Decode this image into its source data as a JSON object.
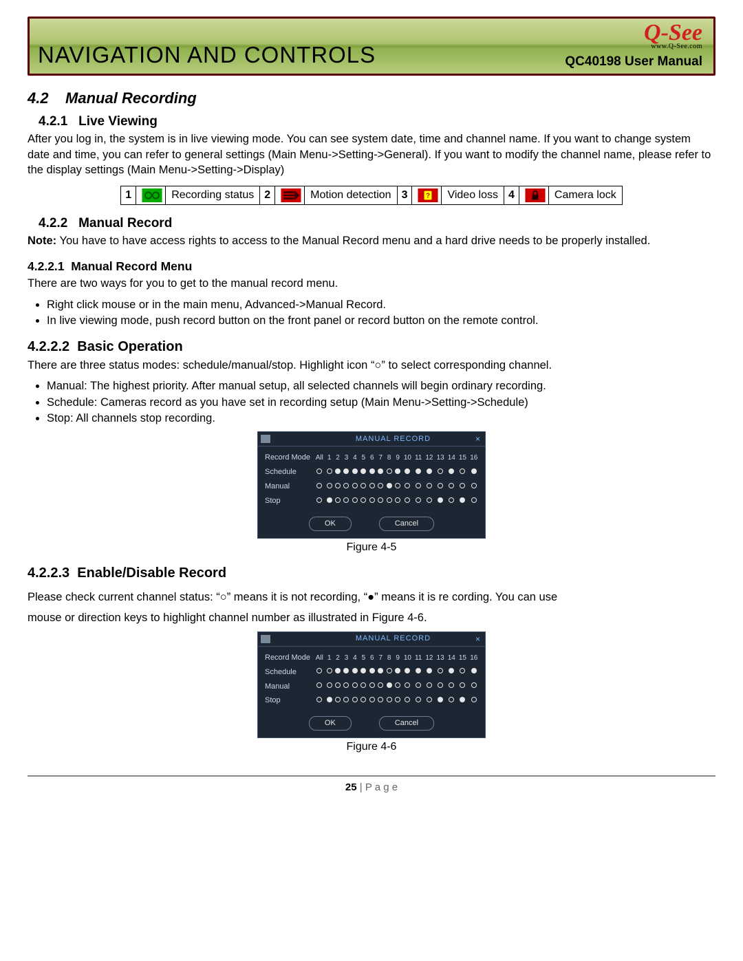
{
  "header": {
    "title": "NAVIGATION AND CONTROLS",
    "brand": "Q-See",
    "brand_url": "www.Q-See.com",
    "subtitle": "QC40198 User Manual"
  },
  "s42": {
    "num": "4.2",
    "title": "Manual Recording"
  },
  "s421": {
    "num": "4.2.1",
    "title": "Live Viewing",
    "body": "After you log in, the system is in live viewing mode. You can see system date, time and channel name. If you want to change system date and time, you can refer to general settings (Main Menu->Setting->General). If you want to modify the channel name, please refer to the display settings (Main Menu->Setting->Display)"
  },
  "legend": [
    {
      "n": "1",
      "label": "Recording status",
      "icon": "rec"
    },
    {
      "n": "2",
      "label": "Motion detection",
      "icon": "motion"
    },
    {
      "n": "3",
      "label": "Video loss",
      "icon": "vloss"
    },
    {
      "n": "4",
      "label": "Camera lock",
      "icon": "lock"
    }
  ],
  "s422": {
    "num": "4.2.2",
    "title": "Manual Record",
    "note_lead": "Note:",
    "note": " You have to have access rights to access to the Manual Record menu and a hard drive needs to be properly installed."
  },
  "s4221": {
    "num": "4.2.2.1",
    "title": "Manual Record Menu",
    "lead": "There are two ways for you to get to the manual record menu.",
    "items": [
      "Right click mouse or in the main menu, Advanced->Manual Record.",
      "In live viewing mode, push record button on the front panel or record button on the remote control."
    ]
  },
  "s4222": {
    "num": "4.2.2.2",
    "title": "Basic Operation",
    "lead": "There are three status modes: schedule/manual/stop. Highlight icon “○”  to select corresponding channel.",
    "items": [
      "Manual: The highest priority. After manual setup, all selected channels will begin ordinary recording.",
      "Schedule: Cameras record as you have set in recording setup (Main Menu->Setting->Schedule)",
      "Stop: All channels stop recording."
    ]
  },
  "dialog": {
    "title": "MANUAL RECORD",
    "close": "×",
    "col_mode": "Record Mode",
    "col_all": "All",
    "channels": [
      "1",
      "2",
      "3",
      "4",
      "5",
      "6",
      "7",
      "8",
      "9",
      "10",
      "11",
      "12",
      "13",
      "14",
      "15",
      "16"
    ],
    "rows": [
      {
        "label": "Schedule",
        "all": "off",
        "v": [
          "off",
          "on",
          "on",
          "on",
          "on",
          "on",
          "on",
          "off",
          "on",
          "on",
          "on",
          "on",
          "off",
          "on",
          "off",
          "on"
        ]
      },
      {
        "label": "Manual",
        "all": "off",
        "v": [
          "off",
          "off",
          "off",
          "off",
          "off",
          "off",
          "off",
          "on",
          "off",
          "off",
          "off",
          "off",
          "off",
          "off",
          "off",
          "off"
        ]
      },
      {
        "label": "Stop",
        "all": "off",
        "v": [
          "on",
          "off",
          "off",
          "off",
          "off",
          "off",
          "off",
          "off",
          "off",
          "off",
          "off",
          "off",
          "on",
          "off",
          "on",
          "off"
        ]
      }
    ],
    "ok": "OK",
    "cancel": "Cancel"
  },
  "fig45": "Figure 4-5",
  "s4223": {
    "num": "4.2.2.3",
    "title": "Enable/Disable Record",
    "p1": "Please check current channel status: “○” means it is not recording, “●” means it is re cording.  You can use",
    "p2": "mouse or direction keys to highlight channel number as illustrated in Figure 4-6."
  },
  "fig46": "Figure 4-6",
  "footer": {
    "page_num": "25",
    "sep": " | ",
    "label": "P a g e"
  }
}
